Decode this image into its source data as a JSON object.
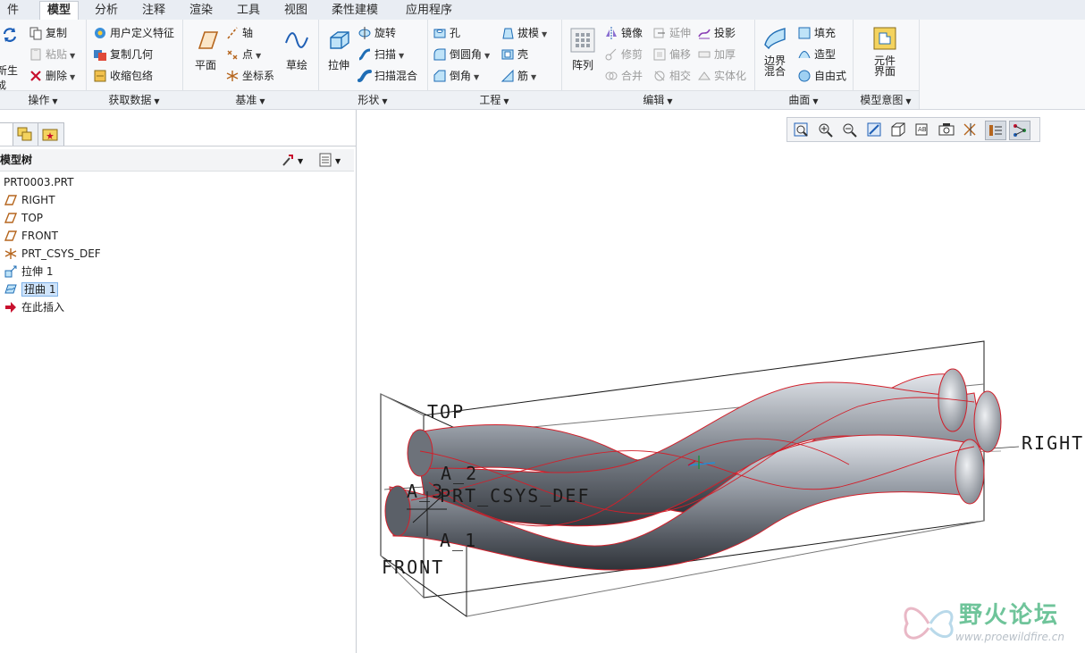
{
  "tabs": [
    "件",
    "模型",
    "分析",
    "注释",
    "渲染",
    "工具",
    "视图",
    "柔性建模",
    "应用程序"
  ],
  "ribbon": {
    "ops": {
      "label": "操作",
      "regen": "新生",
      "regen_sub": "成",
      "copy": "复制",
      "paste": "粘贴",
      "delete": "删除"
    },
    "getdata": {
      "label": "获取数据",
      "udf": "用户定义特征",
      "copygeom": "复制几何",
      "shrinkwrap": "收缩包络"
    },
    "datum": {
      "label": "基准",
      "plane": "平面",
      "axis": "轴",
      "point": "点",
      "csys": "坐标系",
      "sketch": "草绘"
    },
    "shape": {
      "label": "形状",
      "extrude": "拉伸",
      "revolve": "旋转",
      "sweep": "扫描",
      "blend": "扫描混合"
    },
    "engineering": {
      "label": "工程",
      "hole": "孔",
      "round": "倒圆角",
      "chamfer": "倒角",
      "draft": "拔模",
      "shell": "壳",
      "rib": "筋"
    },
    "editing": {
      "label": "编辑",
      "pattern": "阵列",
      "mirror": "镜像",
      "extend": "延伸",
      "project": "投影",
      "trim": "修剪",
      "offset": "偏移",
      "thicken": "加厚",
      "merge": "合并",
      "intersect": "相交",
      "solidify": "实体化"
    },
    "surfaces": {
      "label": "曲面",
      "boundary_l1": "边界",
      "boundary_l2": "混合",
      "fill": "填充",
      "style": "造型",
      "freestyle": "自由式"
    },
    "intent": {
      "label": "模型意图",
      "comp_l1": "元件",
      "comp_l2": "界面"
    }
  },
  "model_tree": {
    "title": "模型树",
    "items": [
      "PRT0003.PRT",
      "RIGHT",
      "TOP",
      "FRONT",
      "PRT_CSYS_DEF",
      "拉伸 1",
      "扭曲 1",
      "在此插入"
    ],
    "selected": "扭曲 1"
  },
  "viewport": {
    "labels": {
      "top": "TOP",
      "right": "RIGHT",
      "front": "FRONT",
      "csys": "PRT_CSYS_DEF",
      "a2": "A_2",
      "a1": "A_1",
      "a3": "A_3"
    },
    "colors": {
      "edge": "#d21f2a",
      "shade_dark": "#3f444b",
      "shade_light": "#c9ced6"
    }
  },
  "watermark": {
    "title": "野火论坛",
    "url": "www.proewildfire.cn"
  }
}
